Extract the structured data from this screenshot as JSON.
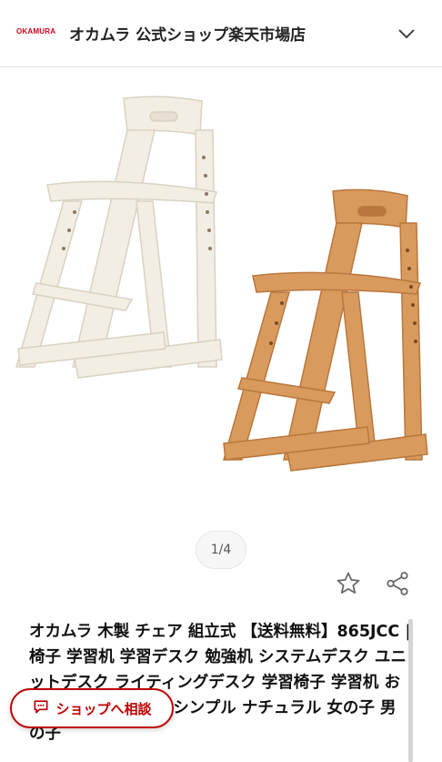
{
  "header": {
    "logo_text": "OKAMURA",
    "shop_name": "オカムラ 公式ショップ楽天市場店"
  },
  "gallery": {
    "pager": "1/4",
    "images": [
      {
        "name": "white-chair",
        "color": "#f1ece1"
      },
      {
        "name": "natural-chair",
        "color": "#d89a5c"
      }
    ]
  },
  "product": {
    "title": "オカムラ 木製 チェア 組立式 【送料無料】865JCC | 椅子 学習机 学習デスク 勉強机 システムデスク ユニットデスク ライティングデスク 学習椅子 学習机 おしゃれ 子供用 木製 シンプル ナチュラル 女の子 男の子"
  },
  "actions": {
    "favorite_icon": "star-outline-icon",
    "share_icon": "share-icon"
  },
  "consult_button": {
    "label": "ショップへ相談",
    "icon": "chat-icon",
    "color": "#bf0000"
  }
}
